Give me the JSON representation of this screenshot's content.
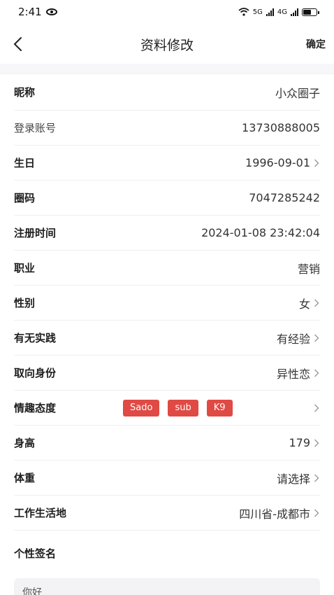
{
  "status_bar": {
    "time": "2:41",
    "network": "5G",
    "network2": "4G"
  },
  "header": {
    "title": "资料修改",
    "confirm_label": "确定"
  },
  "fields": [
    {
      "label": "昵称",
      "value": "小众圈子",
      "arrow": false,
      "bold": true
    },
    {
      "label": "登录账号",
      "value": "13730888005",
      "arrow": false,
      "bold": false
    },
    {
      "label": "生日",
      "value": "1996-09-01",
      "arrow": true,
      "bold": true
    },
    {
      "label": "圈码",
      "value": "7047285242",
      "arrow": false,
      "bold": true
    },
    {
      "label": "注册时间",
      "value": "2024-01-08 23:42:04",
      "arrow": false,
      "bold": true
    },
    {
      "label": "职业",
      "value": "营销",
      "arrow": false,
      "bold": true
    },
    {
      "label": "性别",
      "value": "女",
      "arrow": true,
      "bold": true
    }
  ],
  "practice": {
    "label": "有无实践",
    "value": "有经验"
  },
  "orientation": {
    "label": "取向身份",
    "value": "异性恋"
  },
  "interest": {
    "label": "情趣态度",
    "tags": [
      "Sado",
      "sub",
      "K9"
    ]
  },
  "height": {
    "label": "身高",
    "value": "179"
  },
  "weight": {
    "label": "体重",
    "value": "请选择"
  },
  "location": {
    "label": "工作生活地",
    "value": "四川省-成都市"
  },
  "signature": {
    "label": "个性签名",
    "text": "你好"
  },
  "colors": {
    "tag": "#e04a44",
    "background": "#ffffff"
  }
}
